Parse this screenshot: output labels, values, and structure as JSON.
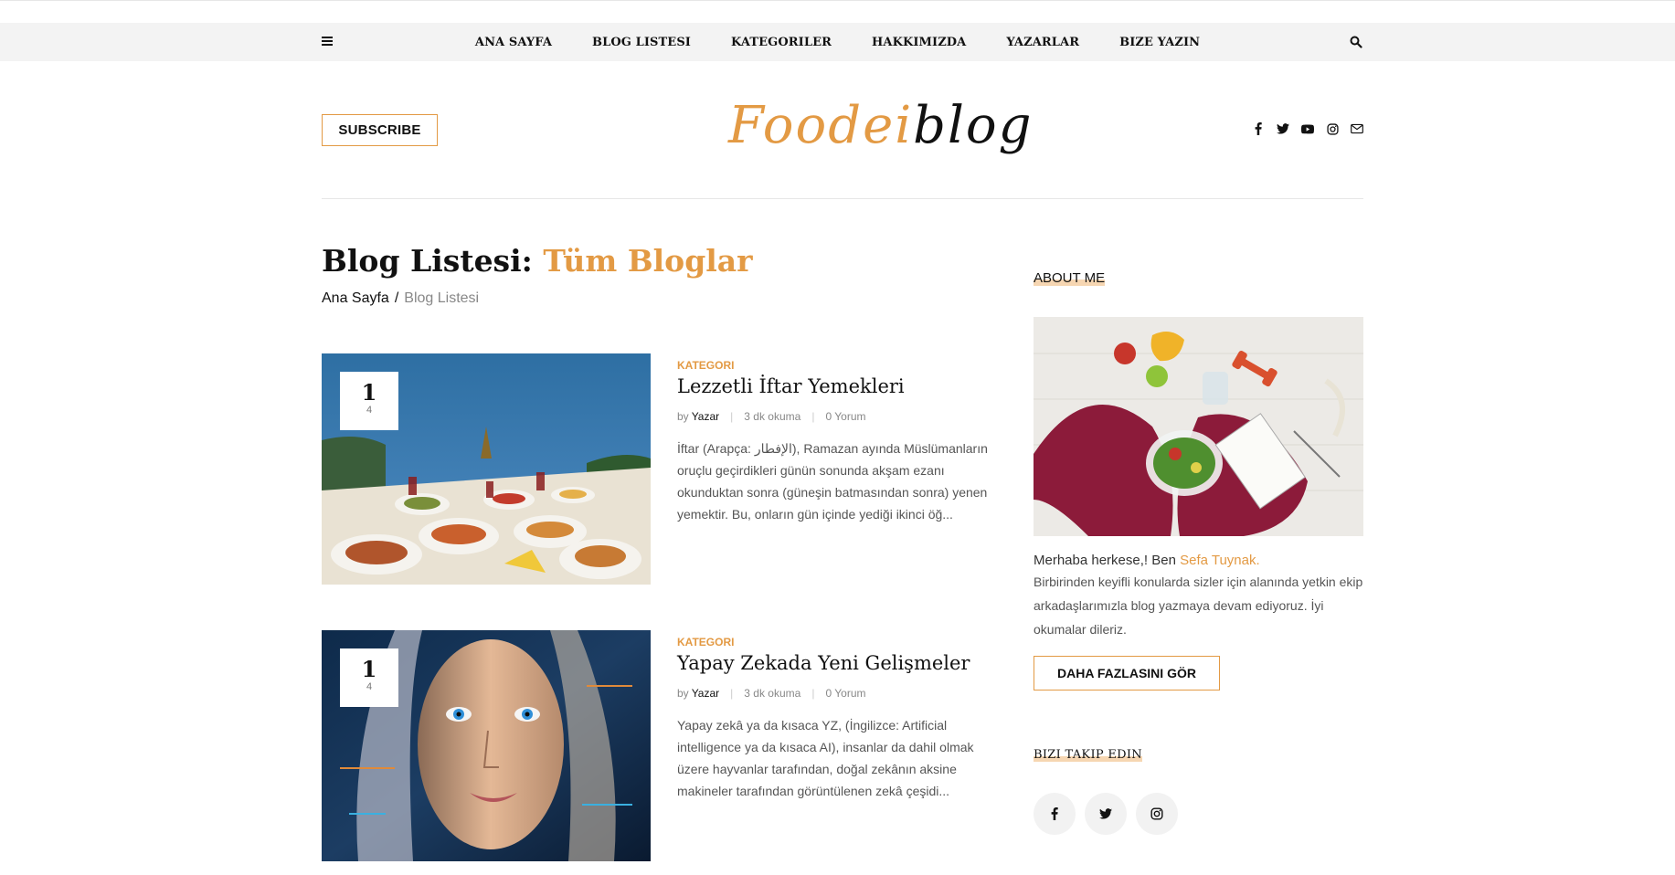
{
  "nav": {
    "items": [
      {
        "label": "ANA SAYFA"
      },
      {
        "label": "BLOG LISTESI"
      },
      {
        "label": "KATEGORILER"
      },
      {
        "label": "HAKKIMIZDA"
      },
      {
        "label": "YAZARLAR"
      },
      {
        "label": "BIZE YAZIN"
      }
    ],
    "menu_icon": "hamburger-icon",
    "search_icon": "search-icon"
  },
  "header": {
    "subscribe_label": "SUBSCRIBE",
    "logo_part1": "Foodei",
    "logo_part2": "blog",
    "social_icons": [
      "facebook-icon",
      "twitter-icon",
      "youtube-icon",
      "instagram-icon",
      "mail-icon"
    ]
  },
  "page": {
    "title_prefix": "Blog Listesi: ",
    "title_accent": "Tüm Bloglar",
    "breadcrumb_home": "Ana Sayfa",
    "breadcrumb_sep": "/",
    "breadcrumb_current": "Blog Listesi"
  },
  "posts": [
    {
      "day": "1",
      "month": "4",
      "category": "KATEGORI",
      "title": "Lezzetli İftar Yemekleri",
      "by": "by",
      "author": "Yazar",
      "read_time": "3 dk okuma",
      "comments": "0 Yorum",
      "excerpt": "İftar (Arapça: الإفطار), Ramazan ayında Müslümanların oruçlu geçirdikleri günün sonunda akşam ezanı okunduktan sonra (güneşin batmasından sonra) yenen yemektir. Bu, onların gün içinde yediği ikinci öğ..."
    },
    {
      "day": "1",
      "month": "4",
      "category": "KATEGORI",
      "title": "Yapay Zekada Yeni Gelişmeler",
      "by": "by",
      "author": "Yazar",
      "read_time": "3 dk okuma",
      "comments": "0 Yorum",
      "excerpt": "Yapay zekâ ya da kısaca YZ, (İngilizce: Artificial intelligence ya da kısaca AI), insanlar da dahil olmak üzere hayvanlar tarafından, doğal zekânın aksine makineler tarafından görüntülenen zekâ çeşidi..."
    }
  ],
  "sidebar": {
    "about_heading": "ABOUT ME",
    "hello_prefix": "Merhaba herkese,! Ben ",
    "author_name": "Sefa Tuynak.",
    "about_desc": "Birbirinden keyifli konularda sizler için alanında yetkin ekip arkadaşlarımızla blog yazmaya devam ediyoruz. İyi okumalar dileriz.",
    "more_label": "DAHA FAZLASINI GÖR",
    "follow_heading": "BIZI TAKIP EDIN",
    "follow_icons": [
      "facebook-icon",
      "twitter-icon",
      "instagram-icon"
    ]
  },
  "colors": {
    "accent": "#e39a44",
    "nav_bg": "#f3f3f3"
  }
}
